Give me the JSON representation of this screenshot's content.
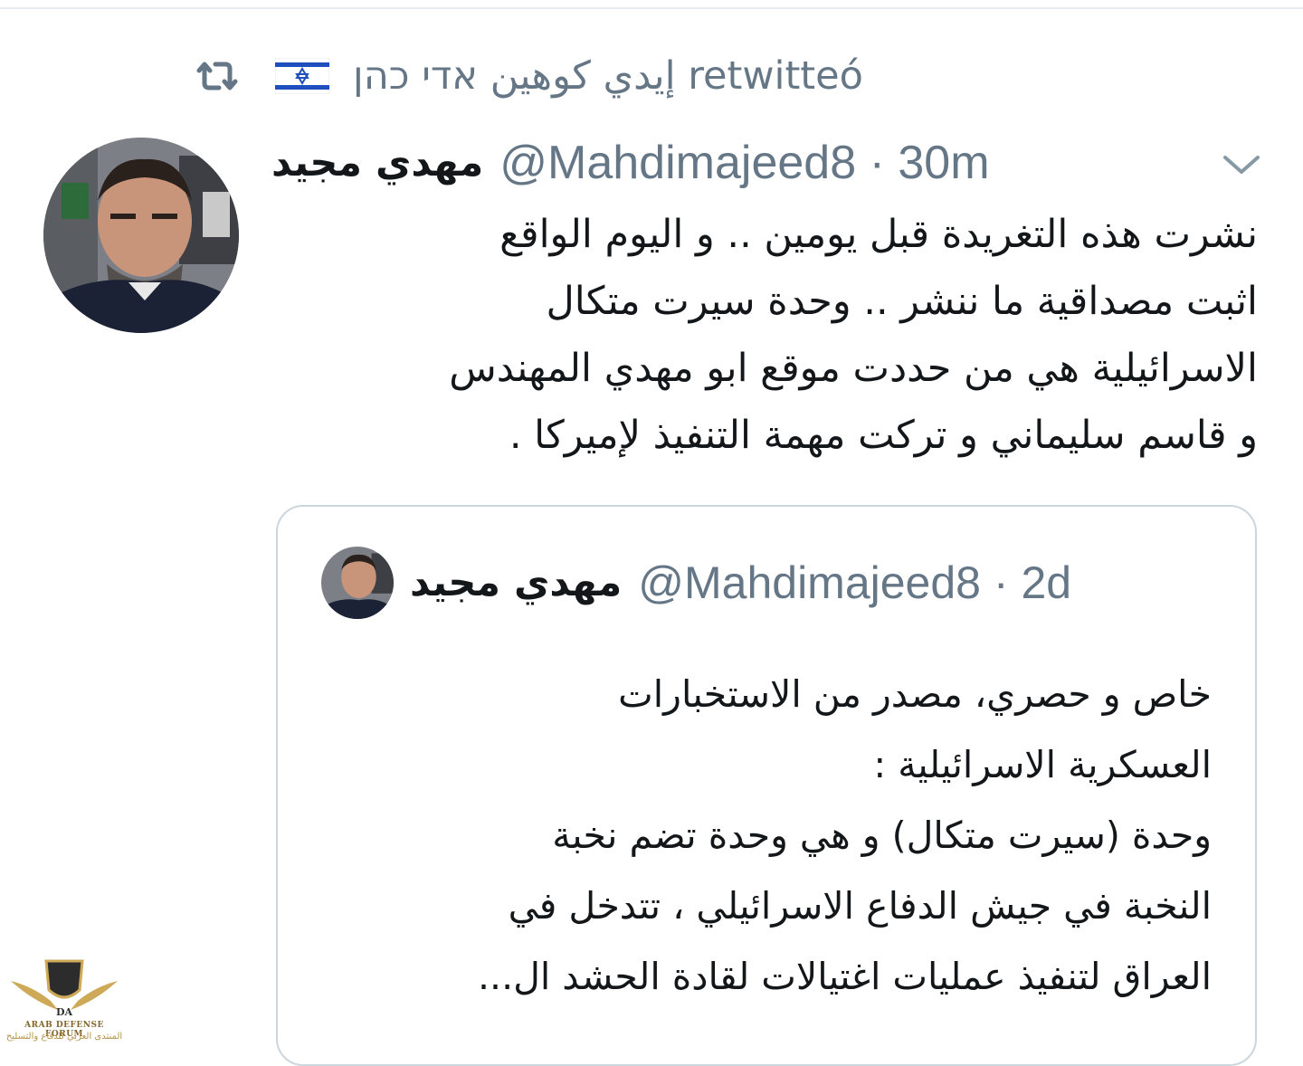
{
  "retweet_context": {
    "icon": "retweet-icon",
    "flag_icon": "israel-flag-icon",
    "text": "إيدي كوهين אדי כהן retwitteó"
  },
  "tweet": {
    "display_name": "مهدي مجيد",
    "handle": "@Mahdimajeed8",
    "time": "30m",
    "separator": "·",
    "menu_icon": "chevron-down-icon",
    "avatar_icon": "profile-photo",
    "lines": [
      "نشرت هذه التغريدة قبل يومين .. و اليوم الواقع",
      "اثبت مصداقية ما ننشر .. وحدة سيرت متكال",
      "الاسرائيلية هي من حددت موقع ابو مهدي المهندس",
      "و قاسم سليماني و تركت مهمة التنفيذ لإميركا ."
    ]
  },
  "quoted_tweet": {
    "display_name": "مهدي مجيد",
    "handle": "@Mahdimajeed8",
    "time": "2d",
    "separator": "·",
    "avatar_icon": "profile-photo",
    "lines": [
      "خاص و حصري، مصدر من الاستخبارات",
      "العسكرية الاسرائيلية :",
      "وحدة (سيرت متكال) و هي وحدة تضم نخبة",
      "النخبة في جيش الدفاع الاسرائيلي ، تتدخل في",
      "العراق لتنفيذ عمليات اغتيالات لقادة الحشد ال..."
    ]
  },
  "watermark": {
    "logo_icon": "arab-defense-forum-logo",
    "line1": "ARAB DEFENSE FORUM",
    "line2": "المنتدى العربي للدفاع والتسليح"
  },
  "colors": {
    "text_primary": "#14171a",
    "text_secondary": "#657786",
    "border": "#ccd6dd"
  }
}
